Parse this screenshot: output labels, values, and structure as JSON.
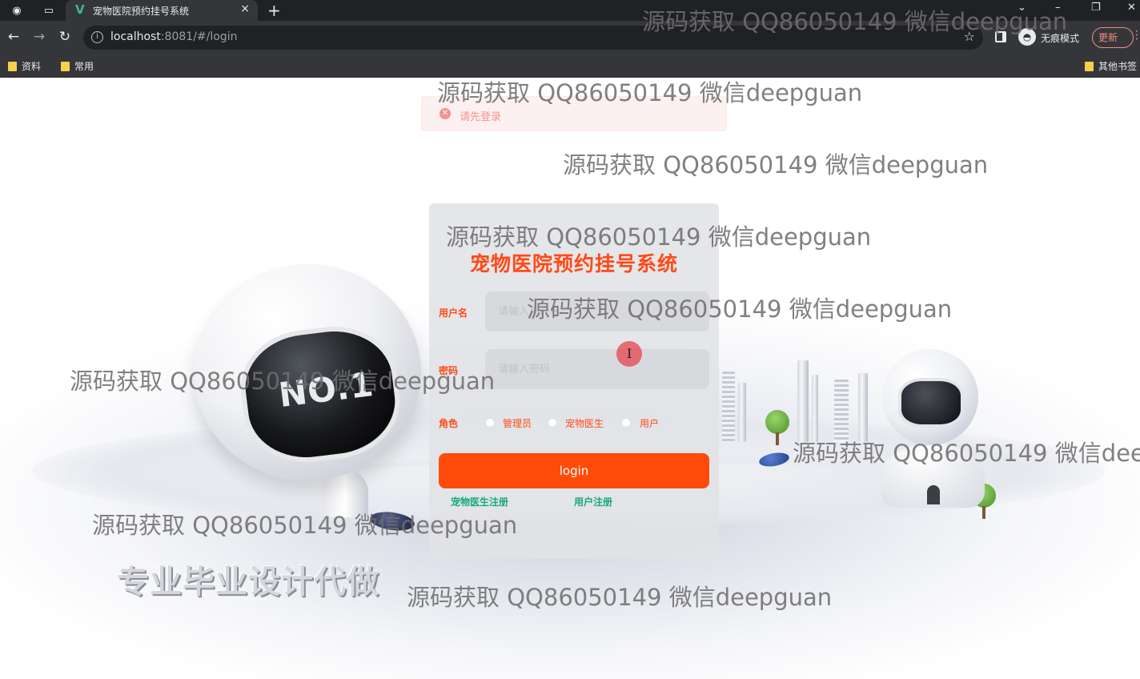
{
  "browser": {
    "tab_title": "宠物医院预约挂号系统",
    "tab_close": "×",
    "new_tab": "+",
    "address_host": "localhost",
    "address_rest": ":8081/#/login",
    "incognito_label": "无痕模式",
    "update_label": "更新",
    "bookmarks": [
      "资料",
      "常用"
    ],
    "other_bookmarks": "其他书签"
  },
  "toast": {
    "type": "error",
    "message": "请先登录"
  },
  "login": {
    "title": "宠物医院预约挂号系统",
    "username_label": "用户名",
    "username_placeholder": "请输入用户名",
    "password_label": "密码",
    "password_placeholder": "请输入密码",
    "role_label": "角色",
    "roles": [
      "管理员",
      "宠物医生",
      "用户"
    ],
    "selected_role": null,
    "submit_label": "login",
    "register_links": [
      "宠物医生注册",
      "用户注册"
    ]
  },
  "background": {
    "robot_badge": "NO.1",
    "promo_text": "专业毕业设计代做"
  },
  "watermark_text": "源码获取 QQ86050149 微信deepguan",
  "colors": {
    "accent": "#ff4a17",
    "button": "#ff4b0a",
    "link": "#15a97a",
    "error": "#f56c6c"
  }
}
